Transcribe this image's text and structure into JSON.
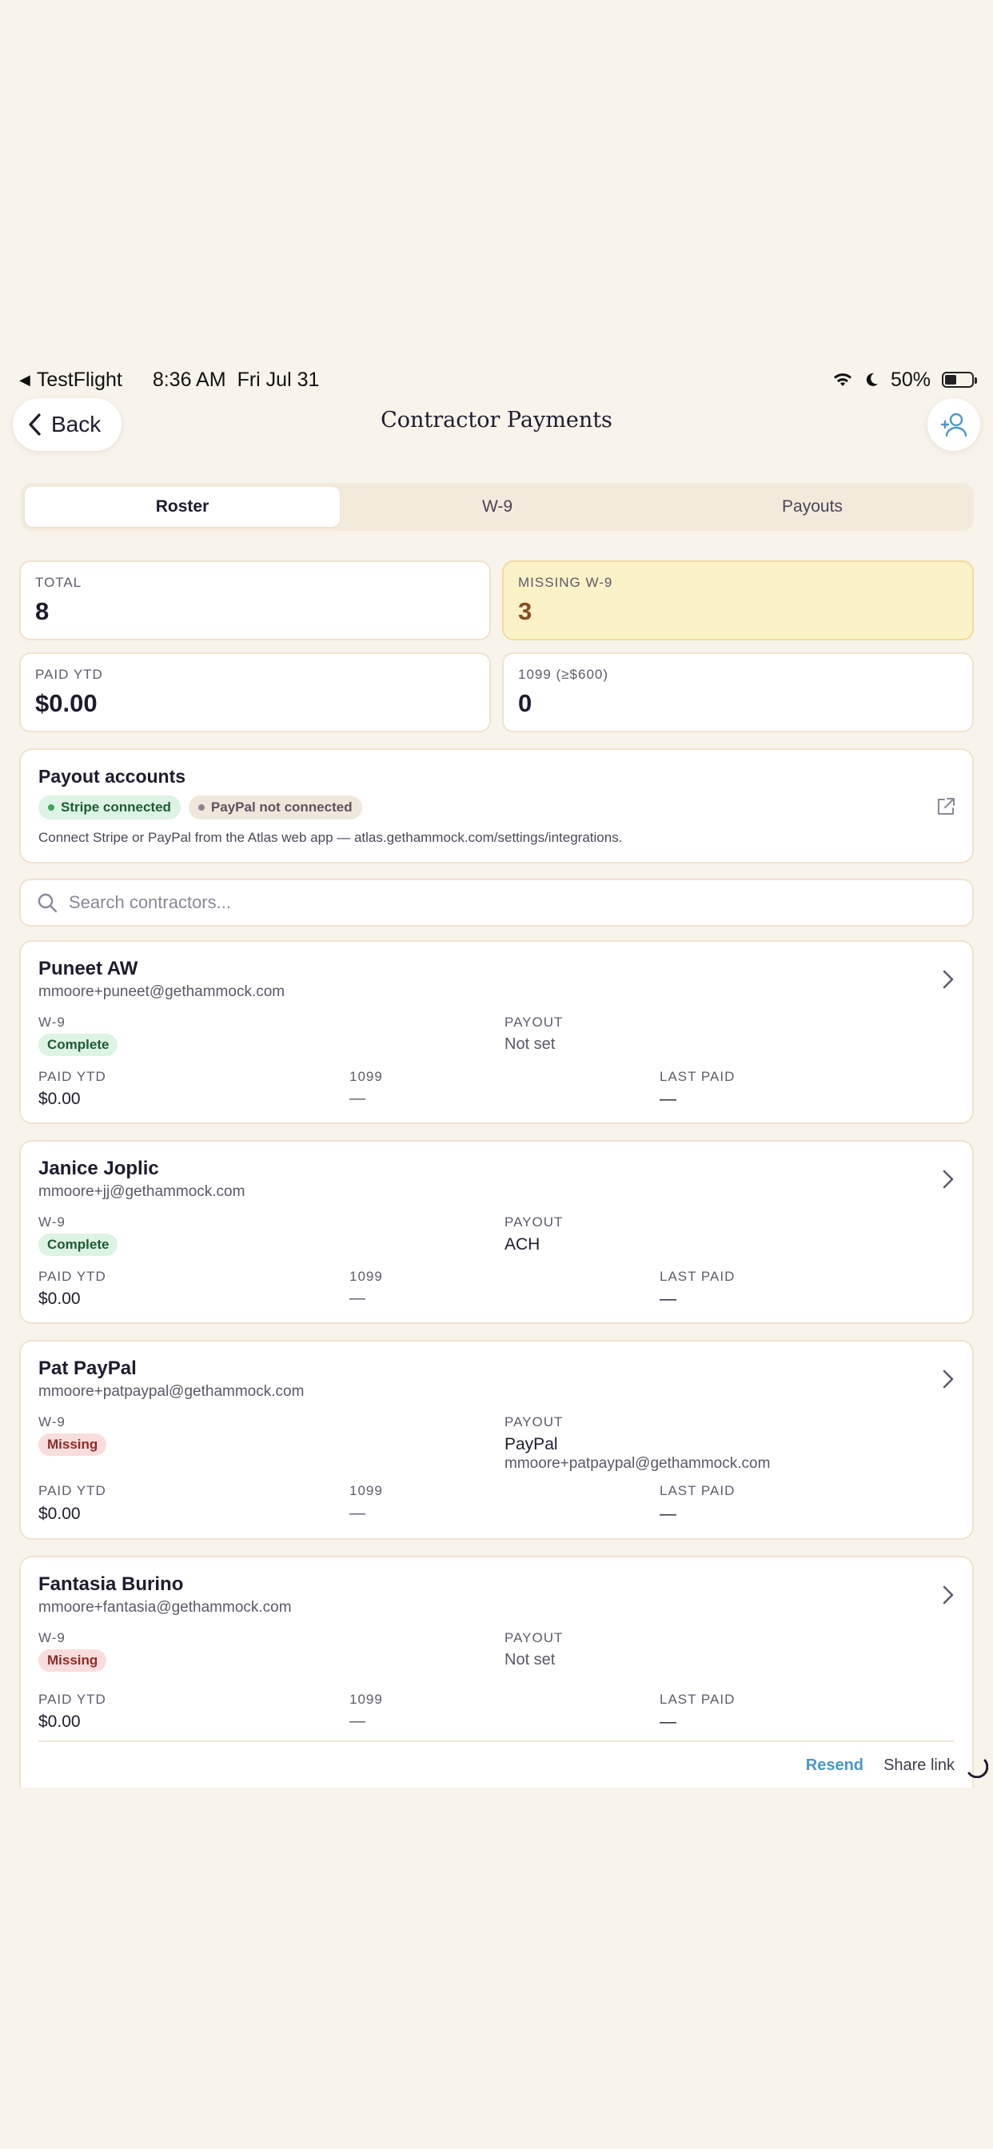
{
  "status_bar": {
    "app": "TestFlight",
    "time": "8:36 AM",
    "date": "Fri Jul 31",
    "battery": "50%"
  },
  "nav": {
    "back_label": "Back",
    "title": "Contractor Payments",
    "add_icon": "add-user-icon"
  },
  "tabs": [
    {
      "label": "Roster",
      "active": true
    },
    {
      "label": "W-9",
      "active": false
    },
    {
      "label": "Payouts",
      "active": false
    }
  ],
  "stats": {
    "total": {
      "label": "TOTAL",
      "value": "8"
    },
    "missing_w9": {
      "label": "MISSING W-9",
      "value": "3"
    },
    "paid_ytd": {
      "label": "PAID YTD",
      "value": "$0.00"
    },
    "f1099": {
      "label": "1099 (≥$600)",
      "value": "0"
    }
  },
  "payout_accounts": {
    "title": "Payout accounts",
    "stripe": "Stripe connected",
    "paypal": "PayPal not connected",
    "note": "Connect Stripe or PayPal from the Atlas web app — atlas.gethammock.com/settings/integrations."
  },
  "search": {
    "placeholder": "Search contractors...",
    "value": ""
  },
  "labels": {
    "w9": "W-9",
    "payout": "PAYOUT",
    "paid_ytd": "PAID YTD",
    "f1099": "1099",
    "last_paid": "LAST PAID"
  },
  "contractors": [
    {
      "name": "Puneet AW",
      "email": "mmoore+puneet@gethammock.com",
      "w9": "Complete",
      "payout": "Not set",
      "paid_ytd": "$0.00",
      "f1099": "—",
      "last_paid": "—"
    },
    {
      "name": "Janice Joplic",
      "email": "mmoore+jj@gethammock.com",
      "w9": "Complete",
      "payout": "ACH",
      "paid_ytd": "$0.00",
      "f1099": "—",
      "last_paid": "—"
    },
    {
      "name": "Pat PayPal",
      "email": "mmoore+patpaypal@gethammock.com",
      "w9": "Missing",
      "payout": "PayPal",
      "payout_detail": "mmoore+patpaypal@gethammock.com",
      "paid_ytd": "$0.00",
      "f1099": "—",
      "last_paid": "—"
    },
    {
      "name": "Fantasia Burino",
      "email": "mmoore+fantasia@gethammock.com",
      "w9": "Missing",
      "payout": "Not set",
      "paid_ytd": "$0.00",
      "f1099": "—",
      "last_paid": "—",
      "actions": {
        "resend": "Resend",
        "share": "Share link"
      }
    }
  ],
  "colors": {
    "background": "#F8F3EB",
    "accent_blue": "#4A97C9",
    "warning_bg": "#FCF2C8",
    "success_bg": "#DDF3E3",
    "danger_bg": "#F9DCDC"
  }
}
